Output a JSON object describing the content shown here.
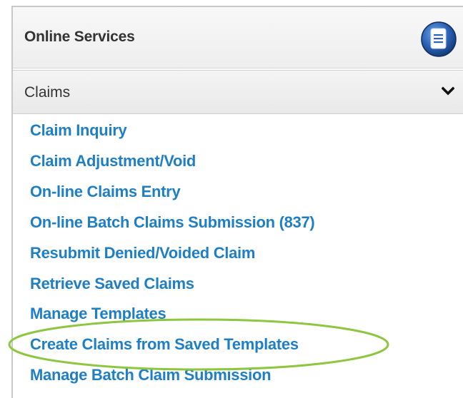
{
  "header": {
    "title": "Online Services",
    "icon": "document-icon"
  },
  "section": {
    "title": "Claims",
    "toggle_icon": "chevron-down-icon",
    "expanded": true
  },
  "links": [
    {
      "label": "Claim Inquiry"
    },
    {
      "label": "Claim Adjustment/Void"
    },
    {
      "label": "On-line Claims Entry"
    },
    {
      "label": "On-line Batch Claims Submission (837)"
    },
    {
      "label": "Resubmit Denied/Voided Claim"
    },
    {
      "label": "Retrieve Saved Claims"
    },
    {
      "label": "Manage Templates"
    },
    {
      "label": "Create Claims from Saved Templates"
    },
    {
      "label": "Manage Batch Claim Submission"
    }
  ],
  "colors": {
    "link": "#1f7fc5",
    "highlight_ellipse": "#8dc63f",
    "header_text": "#333333"
  }
}
